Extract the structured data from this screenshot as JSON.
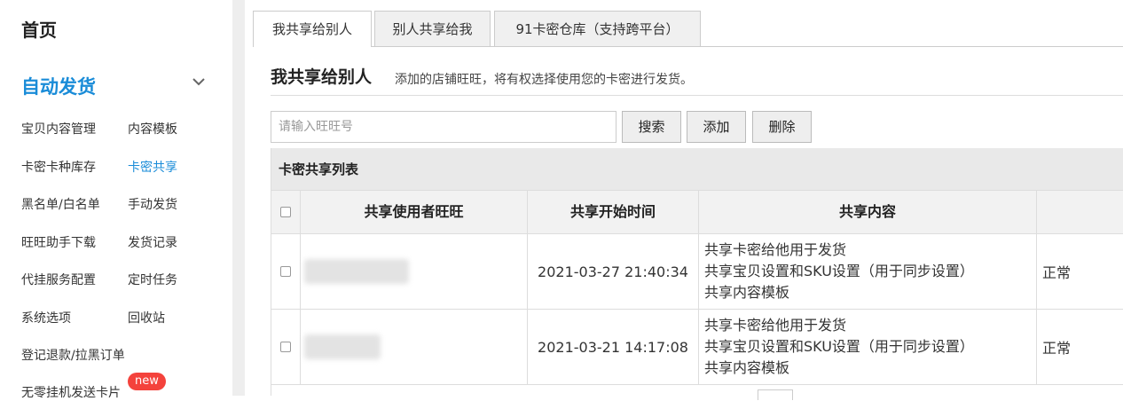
{
  "sidebar": {
    "home": "首页",
    "section": "自动发货",
    "items": [
      {
        "label": "宝贝内容管理"
      },
      {
        "label": "内容模板"
      },
      {
        "label": "卡密卡种库存"
      },
      {
        "label": "卡密共享",
        "active": true
      },
      {
        "label": "黑名单/白名单"
      },
      {
        "label": "手动发货"
      },
      {
        "label": "旺旺助手下载"
      },
      {
        "label": "发货记录"
      },
      {
        "label": "代挂服务配置"
      },
      {
        "label": "定时任务"
      },
      {
        "label": "系统选项"
      },
      {
        "label": "回收站"
      },
      {
        "label": "登记退款/拉黑订单"
      },
      {
        "label": "无零挂机发送卡片"
      }
    ],
    "badge": "new",
    "accent_color": "#1a8cd8"
  },
  "tabs": [
    {
      "label": "我共享给别人",
      "active": true
    },
    {
      "label": "别人共享给我"
    },
    {
      "label": "91卡密仓库（支持跨平台）"
    }
  ],
  "section": {
    "title": "我共享给别人",
    "description": "添加的店铺旺旺，将有权选择使用您的卡密进行发货。"
  },
  "search": {
    "placeholder": "请输入旺旺号",
    "value": "",
    "search_label": "搜索",
    "add_label": "添加",
    "delete_label": "删除"
  },
  "table": {
    "caption": "卡密共享列表",
    "headers": [
      "共享使用者旺旺",
      "共享开始时间",
      "共享内容",
      ""
    ],
    "rows": [
      {
        "time": "2021-03-27 21:40:34",
        "content": [
          "共享卡密给他用于发货",
          "共享宝贝设置和SKU设置（用于同步设置）",
          "共享内容模板"
        ],
        "status": "正常"
      },
      {
        "time": "2021-03-21 14:17:08",
        "content": [
          "共享卡密给他用于发货",
          "共享宝贝设置和SKU设置（用于同步设置）",
          "共享内容模板"
        ],
        "status": "正常"
      }
    ]
  }
}
